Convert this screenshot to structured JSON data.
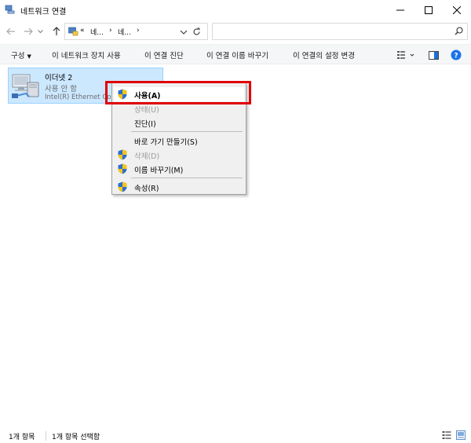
{
  "window": {
    "title": "네트워크 연결",
    "icons": {
      "app": "network-connections-icon",
      "minimize": "minimize-icon",
      "maximize": "maximize-icon",
      "close": "close-icon"
    }
  },
  "address_bar": {
    "prefix": "«",
    "crumbs": [
      "네...",
      "네..."
    ],
    "search_placeholder": "",
    "icons": {
      "back": "back-arrow-icon",
      "forward": "forward-arrow-icon",
      "recent": "chevron-down-icon",
      "up": "up-arrow-icon",
      "dropdown": "chevron-down-icon",
      "refresh": "refresh-icon",
      "search": "search-icon"
    }
  },
  "command_bar": {
    "organize": "구성",
    "disable_device": "이 네트워크 장치 사용",
    "diagnose": "이 연결 진단",
    "rename": "이 연결 이름 바꾸기",
    "change_settings": "이 연결의 설정 변경",
    "icons": {
      "view_options": "view-options-icon",
      "preview_pane": "preview-pane-icon",
      "help": "help-icon"
    }
  },
  "connection": {
    "name": "이더넷 2",
    "status": "사용 안 함",
    "device": "Intel(R) Ethernet Connection"
  },
  "context_menu": {
    "items": [
      {
        "label": "사용(A)",
        "shield": true,
        "disabled": false,
        "highlight": true
      },
      {
        "label": "상태(U)",
        "shield": false,
        "disabled": true
      },
      {
        "label": "진단(I)",
        "shield": false,
        "disabled": false
      },
      {
        "label": "바로 가기 만들기(S)",
        "shield": false,
        "disabled": false
      },
      {
        "label": "삭제(D)",
        "shield": true,
        "disabled": true
      },
      {
        "label": "이름 바꾸기(M)",
        "shield": true,
        "disabled": false
      },
      {
        "label": "속성(R)",
        "shield": true,
        "disabled": false
      }
    ]
  },
  "status_bar": {
    "item_count": "1개 항목",
    "selected_count": "1개 항목 선택함",
    "icons": {
      "details_view": "details-view-icon",
      "large_icons_view": "large-icons-view-icon"
    }
  },
  "colors": {
    "selection_bg": "#cce8ff",
    "selection_border": "#99d1ff",
    "highlight_box": "#e00000",
    "command_bar_bg": "#f5f6f8",
    "menu_bg": "#f0f0f0",
    "help_blue": "#1a73e8"
  }
}
